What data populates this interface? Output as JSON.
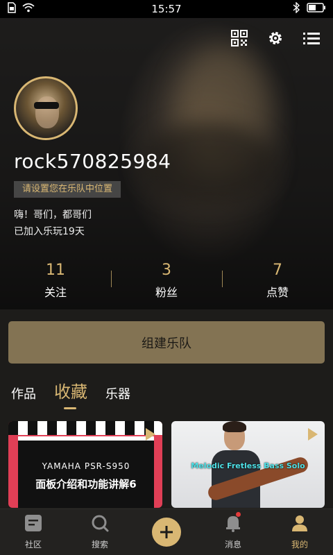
{
  "status_bar": {
    "time": "15:57"
  },
  "profile": {
    "username": "rock570825984",
    "position_prompt": "请设置您在乐队中位置",
    "bio": "嗨！哥们，都哥们",
    "joined": "已加入乐玩19天"
  },
  "stats": [
    {
      "value": "11",
      "label": "关注"
    },
    {
      "value": "3",
      "label": "粉丝"
    },
    {
      "value": "7",
      "label": "点赞"
    }
  ],
  "build_band_label": "组建乐队",
  "tabs": [
    {
      "label": "作品",
      "active": false
    },
    {
      "label": "收藏",
      "active": true
    },
    {
      "label": "乐器",
      "active": false
    }
  ],
  "cards": [
    {
      "line1": "YAMAHA PSR-S950",
      "line2": "面板介绍和功能讲解6"
    },
    {
      "title": "Melodic Fretless Bass Solo"
    }
  ],
  "nav": [
    {
      "label": "社区",
      "icon": "community-icon"
    },
    {
      "label": "搜索",
      "icon": "search-icon"
    },
    {
      "label": "",
      "icon": "plus-icon"
    },
    {
      "label": "消息",
      "icon": "bell-icon"
    },
    {
      "label": "我的",
      "icon": "profile-icon"
    }
  ],
  "colors": {
    "accent": "#d9b773",
    "button": "#837353",
    "background": "#1d1c1a",
    "notification": "#e23a3a"
  }
}
